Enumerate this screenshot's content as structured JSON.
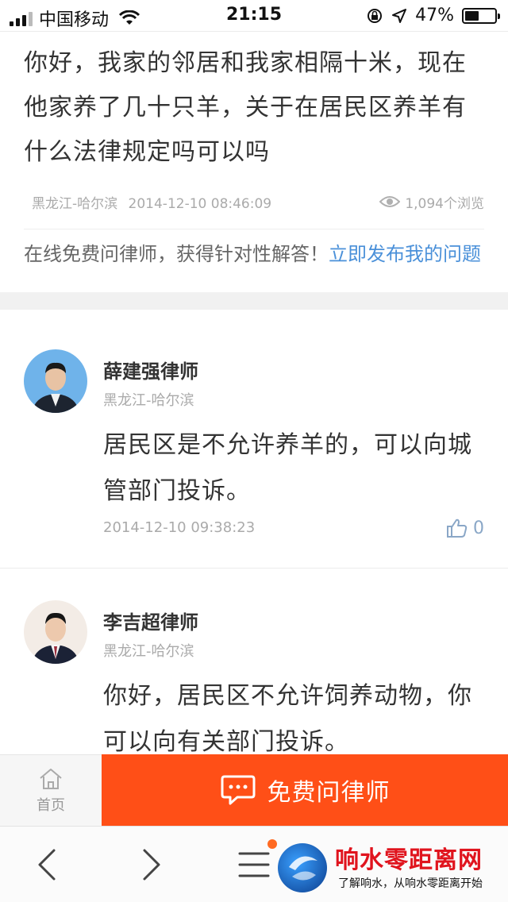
{
  "status_bar": {
    "carrier": "中国移动",
    "time": "21:15",
    "battery_percent": "47%",
    "battery_level": 0.47
  },
  "question": {
    "text": "你好，我家的邻居和我家相隔十米，现在他家养了几十只羊，关于在居民区养羊有什么法律规定吗可以吗",
    "location": "黑龙江-哈尔滨",
    "datetime": "2014-12-10 08:46:09",
    "views": "1,094个浏览"
  },
  "promo": {
    "text": "在线免费问律师，获得针对性解答！",
    "link": "立即发布我的问题"
  },
  "answers": [
    {
      "name": "薛建强律师",
      "location": "黑龙江-哈尔滨",
      "text": "居民区是不允许养羊的，可以向城管部门投诉。",
      "datetime": "2014-12-10 09:38:23",
      "likes": "0"
    },
    {
      "name": "李吉超律师",
      "location": "黑龙江-哈尔滨",
      "text": "你好，居民区不允许饲养动物，你可以向有关部门投诉。"
    }
  ],
  "action_bar": {
    "home_label": "首页",
    "ask_label": "免费问律师",
    "accent_color": "#ff4f17"
  },
  "watermark": {
    "title": "响水零距离网",
    "subtitle": "了解响水，从响水零距离开始"
  },
  "icons": {
    "views": "eye-icon",
    "like": "thumbs-up-icon",
    "home": "home-icon",
    "ask": "chat-bubble-icon",
    "back": "chevron-left-icon",
    "forward": "chevron-right-icon",
    "menu": "menu-icon"
  }
}
